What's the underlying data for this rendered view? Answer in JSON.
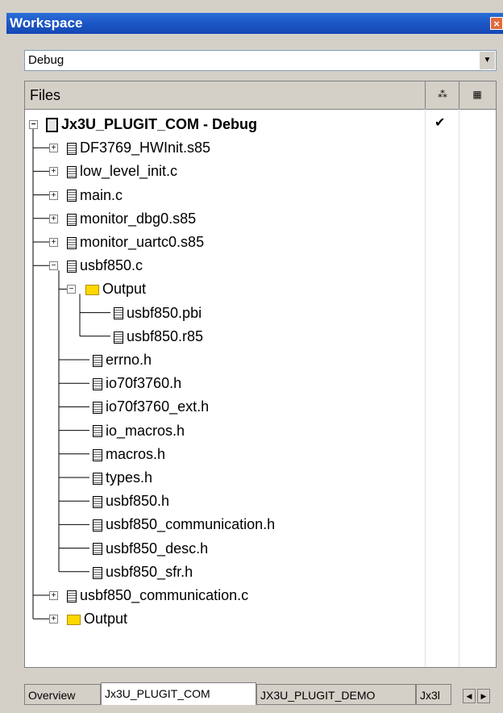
{
  "window": {
    "title": "Workspace",
    "close_label": "×"
  },
  "config_combo": {
    "value": "Debug",
    "arrow_icon": "chevron-down-icon"
  },
  "tree_header": {
    "files_label": "Files",
    "col1_icon": "make-icon",
    "col2_icon": "options-icon"
  },
  "tree": [
    {
      "label": "Jx3U_PLUGIT_COM - Debug",
      "type": "project",
      "check": "✔",
      "expander": "⊟"
    },
    {
      "label": "DF3769_HWInit.s85",
      "type": "file",
      "expander": "⊞"
    },
    {
      "label": "low_level_init.c",
      "type": "file",
      "expander": "⊞"
    },
    {
      "label": "main.c",
      "type": "file",
      "expander": "⊞"
    },
    {
      "label": "monitor_dbg0.s85",
      "type": "file",
      "expander": "⊞"
    },
    {
      "label": "monitor_uartc0.s85",
      "type": "file",
      "expander": "⊞"
    },
    {
      "label": "usbf850.c",
      "type": "file",
      "expander": "⊟"
    },
    {
      "label": "Output",
      "type": "folder",
      "expander": "⊟"
    },
    {
      "label": "usbf850.pbi",
      "type": "file",
      "expander": ""
    },
    {
      "label": "usbf850.r85",
      "type": "file",
      "expander": ""
    },
    {
      "label": "errno.h",
      "type": "file",
      "expander": ""
    },
    {
      "label": "io70f3760.h",
      "type": "file",
      "expander": ""
    },
    {
      "label": "io70f3760_ext.h",
      "type": "file",
      "expander": ""
    },
    {
      "label": "io_macros.h",
      "type": "file",
      "expander": ""
    },
    {
      "label": "macros.h",
      "type": "file",
      "expander": ""
    },
    {
      "label": "types.h",
      "type": "file",
      "expander": ""
    },
    {
      "label": "usbf850.h",
      "type": "file",
      "expander": ""
    },
    {
      "label": "usbf850_communication.h",
      "type": "file",
      "expander": ""
    },
    {
      "label": "usbf850_desc.h",
      "type": "file",
      "expander": ""
    },
    {
      "label": "usbf850_sfr.h",
      "type": "file",
      "expander": ""
    },
    {
      "label": "usbf850_communication.c",
      "type": "file",
      "expander": "⊞"
    },
    {
      "label": "Output",
      "type": "folder",
      "expander": "⊞"
    }
  ],
  "tabs": [
    "Overview",
    "Jx3U_PLUGIT_COM",
    "JX3U_PLUGIT_DEMO",
    "Jx3l"
  ],
  "scroll": {
    "left_icon": "◀",
    "right_icon": "▶"
  }
}
